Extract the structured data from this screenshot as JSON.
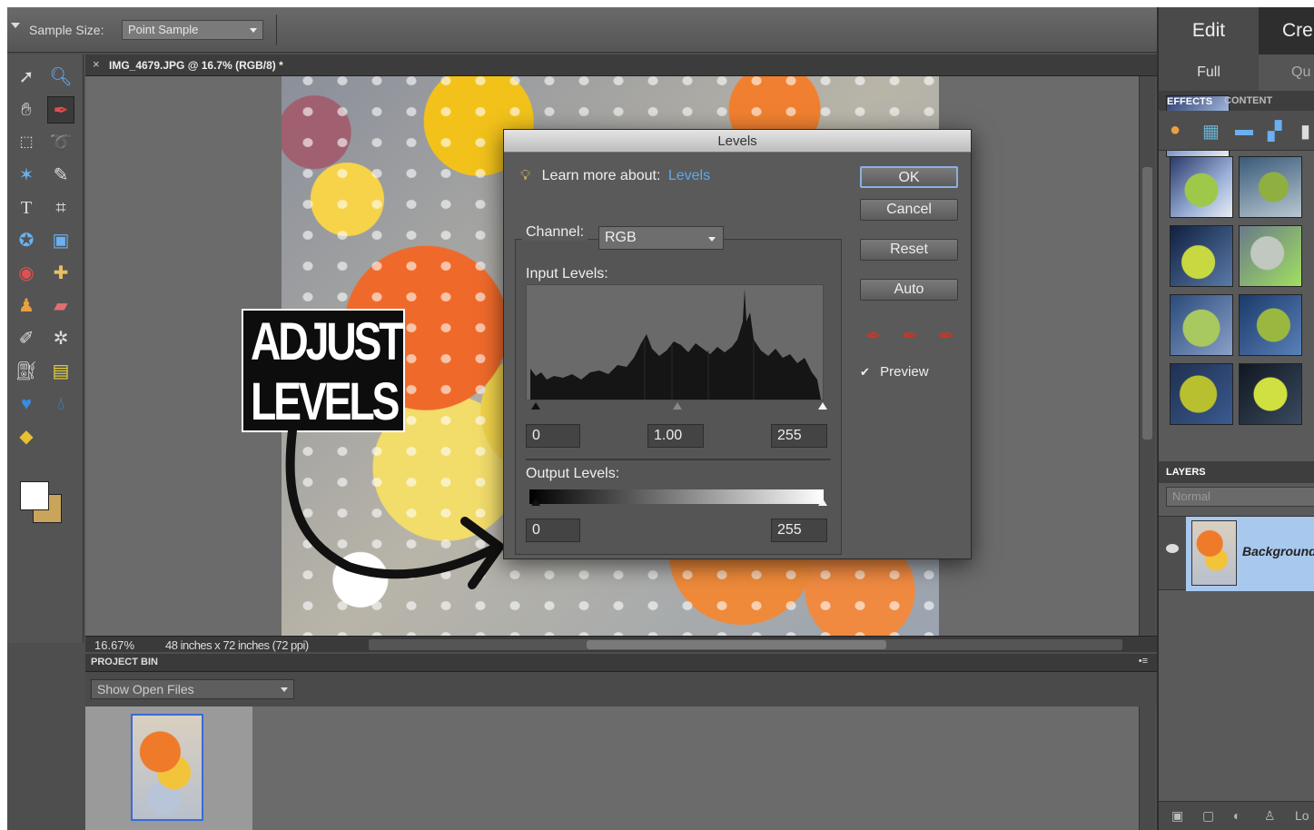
{
  "options_bar": {
    "sample_size_label": "Sample Size:",
    "sample_size_value": "Point Sample"
  },
  "toolbox": {
    "tools": [
      "move-icon",
      "zoom-icon",
      "hand-icon",
      "eyedropper-icon",
      "marquee-icon",
      "lasso-icon",
      "magic-wand-icon",
      "quick-selection-icon",
      "type-icon",
      "crop-icon",
      "custom-shape-icon",
      "recompose-icon",
      "red-eye-icon",
      "healing-brush-icon",
      "clone-stamp-icon",
      "eraser-icon",
      "brush-icon",
      "smart-brush-icon",
      "paint-bucket-icon",
      "gradient-icon",
      "cookie-cutter-icon",
      "blur-icon",
      "sponge-icon"
    ],
    "foreground_color": "#ffffff",
    "background_color": "#c9a45a"
  },
  "document": {
    "tab_title": "IMG_4679.JPG @ 16.7% (RGB/8) *",
    "close_glyph": "×",
    "zoom": "16.67%",
    "dimensions": "48 inches x 72 inches (72 ppi)"
  },
  "annotation": {
    "line1": "ADJUST",
    "line2": "LEVELS"
  },
  "levels_dialog": {
    "title": "Levels",
    "learn_more_label": "Learn more about:",
    "learn_more_link": "Levels",
    "buttons": {
      "ok": "OK",
      "cancel": "Cancel",
      "reset": "Reset",
      "auto": "Auto"
    },
    "channel_label": "Channel:",
    "channel_value": "RGB",
    "input_levels_label": "Input Levels:",
    "input_black": "0",
    "input_gamma": "1.00",
    "input_white": "255",
    "output_levels_label": "Output Levels:",
    "output_black": "0",
    "output_white": "255",
    "preview_label": "Preview",
    "preview_checked": true,
    "dropper_icons": [
      "black-eyedropper-icon",
      "gray-eyedropper-icon",
      "white-eyedropper-icon"
    ]
  },
  "project_bin": {
    "title": "PROJECT BIN",
    "menu_glyph": "•≡",
    "show_select": "Show Open Files"
  },
  "right_panel": {
    "tab_edit": "Edit",
    "tab_create": "Cre",
    "subtab_full": "Full",
    "subtab_quick": "Qu",
    "panel_tab_effects": "EFFECTS",
    "panel_tab_content": "CONTENT",
    "layers_title": "LAYERS",
    "blend_mode": "Normal",
    "layer_name": "Background",
    "bottom_text": "Lo"
  },
  "colors": {
    "accent_link": "#5aa9f0",
    "selection_blue": "#a8c8ee"
  }
}
